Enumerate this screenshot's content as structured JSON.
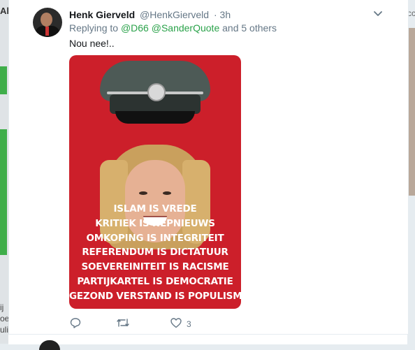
{
  "background": {
    "left_top_text": "Ab",
    "left_bottom_lines": [
      "ij",
      "oe",
      "uli"
    ],
    "right_top_text": "cc"
  },
  "tweet": {
    "author_name": "Henk Gierveld",
    "author_handle": "@HenkGierveld",
    "separator": "·",
    "time": "3h",
    "replying_prefix": "Replying to",
    "reply_mention_1": "@D66",
    "reply_mention_2": "@SanderQuote",
    "reply_suffix": "and 5 others",
    "text": "Nou nee!..",
    "image_slogans": [
      "ISLAM IS VREDE",
      "KRITIEK IS NEPNIEUWS",
      "OMKOPING IS INTEGRITEIT",
      "REFERENDUM IS DICTATUUR",
      "SOEVEREINITEIT IS RACISME",
      "PARTIJKARTEL IS DEMOCRATIE",
      "GEZOND VERSTAND IS POPULISME"
    ],
    "actions": {
      "reply_icon": "reply-icon",
      "retweet_icon": "retweet-icon",
      "like_icon": "heart-icon",
      "like_count": "3"
    }
  },
  "colors": {
    "link_green": "#2aa24a",
    "meta_gray": "#657786",
    "media_red": "#cc1f2a"
  }
}
